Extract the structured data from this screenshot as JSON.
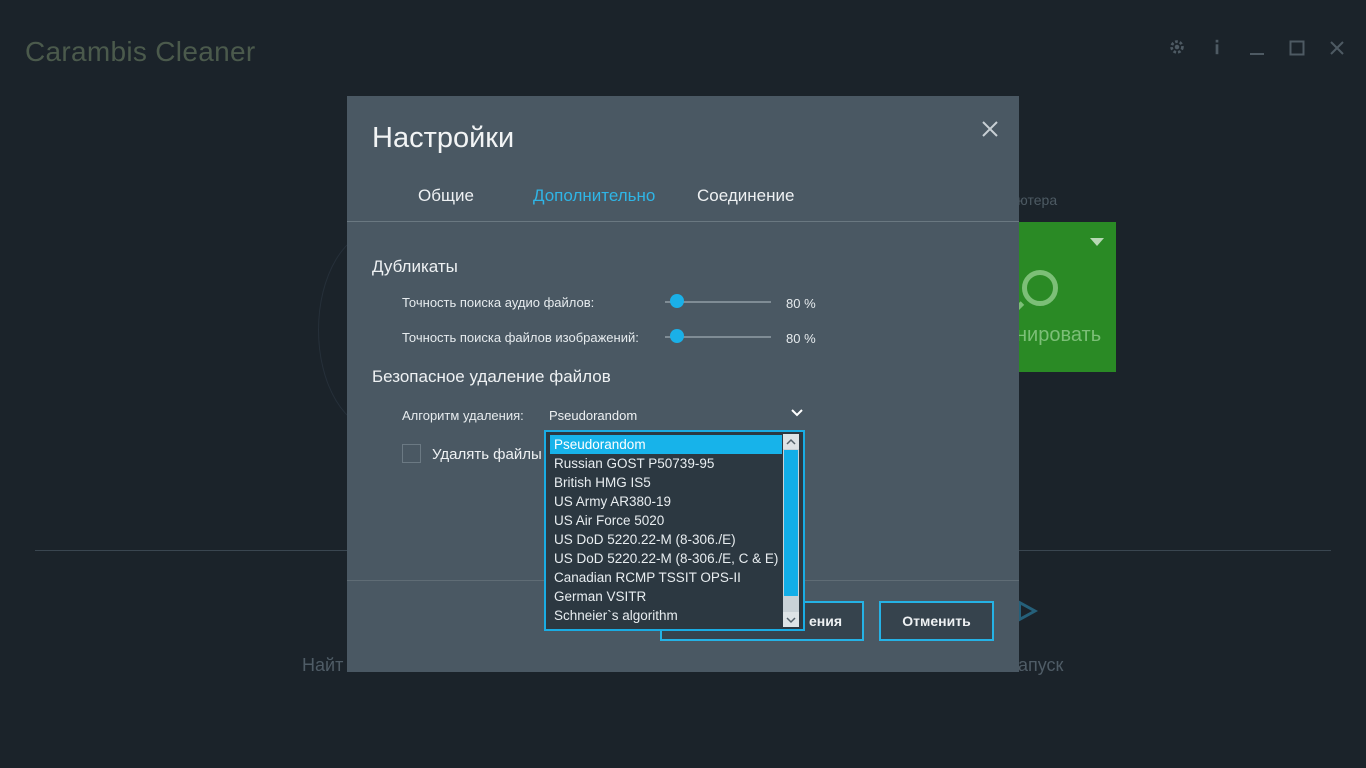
{
  "app": {
    "title": "Carambis Cleaner",
    "subtitle_fragment": "ьютера",
    "scan_tile_label": "нировать",
    "bottom_left_fragment": "Найт",
    "bottom_right_fragment": "апуск"
  },
  "window_controls": {
    "settings_icon": "gear-icon",
    "info_icon": "info-icon",
    "minimize": "minimize-icon",
    "maximize": "maximize-icon",
    "close": "close-icon"
  },
  "dialog": {
    "title": "Настройки",
    "tabs": [
      {
        "label": "Общие",
        "active": false
      },
      {
        "label": "Дополнительно",
        "active": true
      },
      {
        "label": "Соединение",
        "active": false
      }
    ],
    "duplicates": {
      "title": "Дубликаты",
      "audio_label": "Точность поиска аудио файлов:",
      "audio_value": 80,
      "audio_value_text": "80 %",
      "image_label": "Точность поиска файлов изображений:",
      "image_value": 80,
      "image_value_text": "80 %"
    },
    "secure_delete": {
      "title": "Безопасное удаление файлов",
      "algorithm_label": "Алгоритм удаления:",
      "algorithm_value": "Pseudorandom",
      "checkbox_label": "Удалять файлы б",
      "checkbox_checked": false
    },
    "buttons": {
      "save_label": "ения",
      "cancel_label": "Отменить"
    }
  },
  "dropdown": {
    "options": [
      "Pseudorandom",
      "Russian GOST P50739-95",
      "British HMG IS5",
      "US Army AR380-19",
      "US Air Force 5020",
      "US DoD 5220.22-M (8-306./E)",
      "US DoD 5220.22-M (8-306./E, C & E)",
      "Canadian RCMP TSSIT OPS-II",
      "German VSITR",
      "Schneier`s algorithm"
    ],
    "selected_index": 0
  },
  "colors": {
    "accent": "#1ab0e8",
    "dialog_bg": "#4a5863",
    "app_bg": "#1b232a",
    "scan_green": "#2a8a25"
  }
}
